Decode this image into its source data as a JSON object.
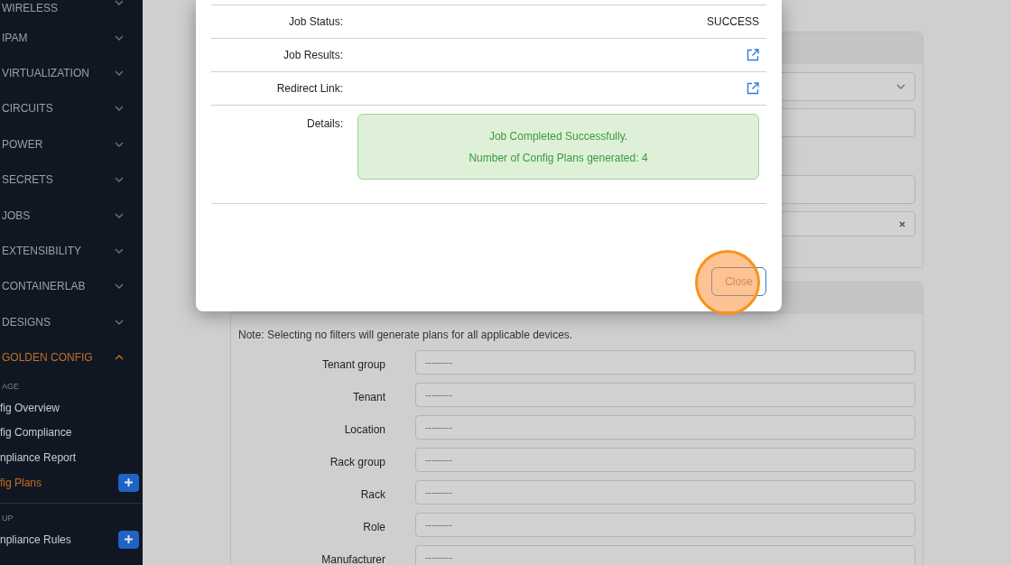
{
  "sidebar": {
    "sections": [
      {
        "label": "WIRELESS",
        "expanded": false
      },
      {
        "label": "IPAM",
        "expanded": false
      },
      {
        "label": "VIRTUALIZATION",
        "expanded": false
      },
      {
        "label": "CIRCUITS",
        "expanded": false
      },
      {
        "label": "POWER",
        "expanded": false
      },
      {
        "label": "SECRETS",
        "expanded": false
      },
      {
        "label": "JOBS",
        "expanded": false
      },
      {
        "label": "EXTENSIBILITY",
        "expanded": false
      },
      {
        "label": "CONTAINERLAB",
        "expanded": false
      },
      {
        "label": "DESIGNS",
        "expanded": false
      },
      {
        "label": "GOLDEN CONFIG",
        "expanded": true
      }
    ],
    "groups": [
      {
        "heading": "AGE",
        "items": [
          {
            "label": "fig Overview",
            "selected": false,
            "add_button": false
          },
          {
            "label": "fig Compliance",
            "selected": false,
            "add_button": false
          },
          {
            "label": "npliance Report",
            "selected": false,
            "add_button": false
          },
          {
            "label": "fig Plans",
            "selected": true,
            "add_button": true
          }
        ]
      },
      {
        "heading": "UP",
        "items": [
          {
            "label": "npliance Rules",
            "selected": false,
            "add_button": true
          }
        ]
      }
    ]
  },
  "form": {
    "top_fields": [
      {
        "kind": "select"
      },
      {
        "kind": "text"
      },
      {
        "kind": "text"
      },
      {
        "kind": "clearable"
      }
    ],
    "filters": {
      "note": "Note: Selecting no filters will generate plans for all applicable devices.",
      "fields": [
        {
          "label": "Tenant group",
          "placeholder": "---------"
        },
        {
          "label": "Tenant",
          "placeholder": "---------"
        },
        {
          "label": "Location",
          "placeholder": "---------"
        },
        {
          "label": "Rack group",
          "placeholder": "---------"
        },
        {
          "label": "Rack",
          "placeholder": "---------"
        },
        {
          "label": "Role",
          "placeholder": "---------"
        },
        {
          "label": "Manufacturer",
          "placeholder": "---------"
        }
      ]
    }
  },
  "modal": {
    "rows": [
      {
        "label": "Job Status:",
        "kind": "text",
        "value": "SUCCESS"
      },
      {
        "label": "Job Results:",
        "kind": "link"
      },
      {
        "label": "Redirect Link:",
        "kind": "link"
      }
    ],
    "details": {
      "label": "Details:",
      "lines": [
        "Job Completed Successfully.",
        "Number of Config Plans generated: 4"
      ]
    },
    "close_button": "Close"
  }
}
